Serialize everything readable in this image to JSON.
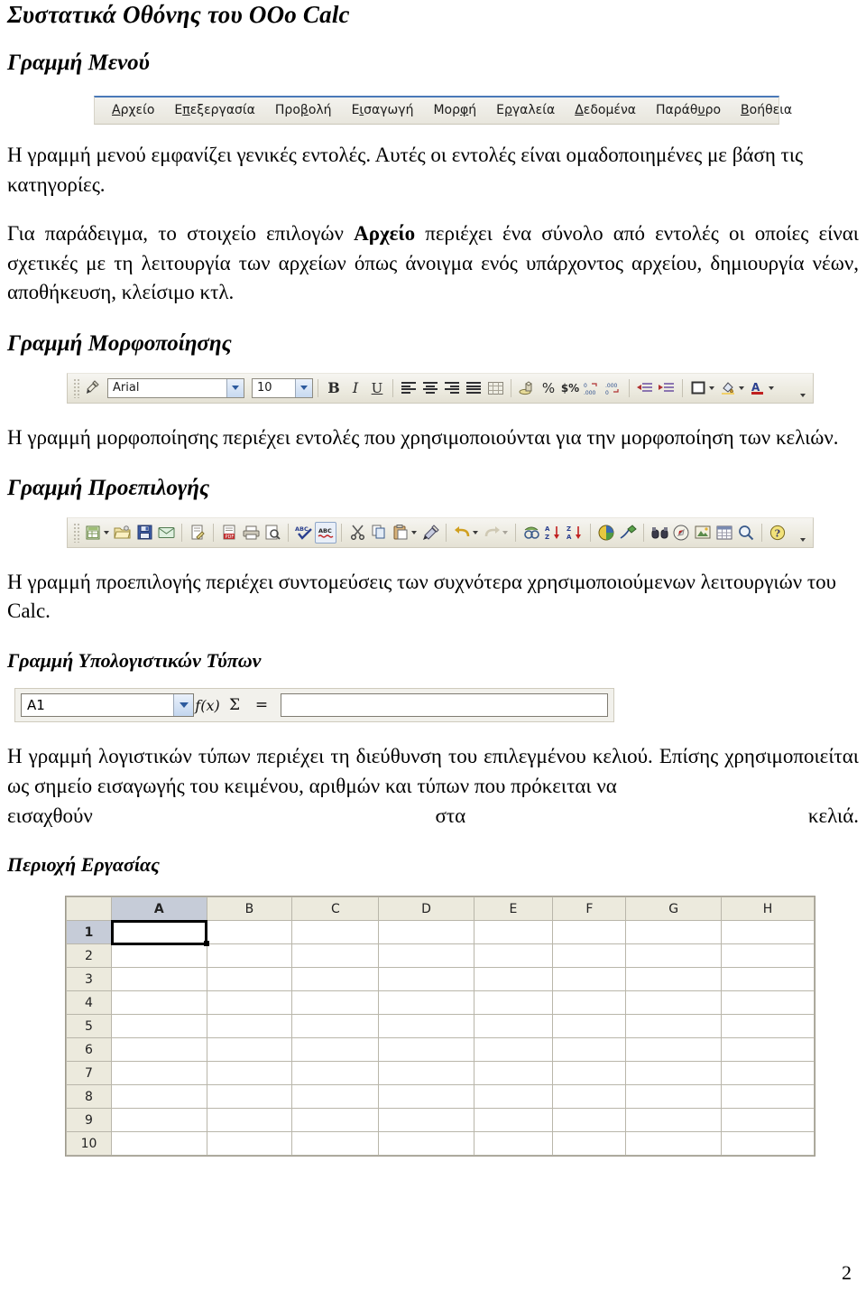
{
  "document": {
    "title": "Συστατικά Οθόνης του ΟΟo Calc",
    "page_number": "2"
  },
  "sections": {
    "menubar": {
      "heading": "Γραμμή Μενού",
      "items": [
        {
          "pre": "",
          "acc": "Α",
          "post": "ρχείο"
        },
        {
          "pre": "Ε",
          "acc": "π",
          "post": "εξεργασία"
        },
        {
          "pre": "Προ",
          "acc": "β",
          "post": "ολή"
        },
        {
          "pre": "Ε",
          "acc": "ι",
          "post": "σαγωγή"
        },
        {
          "pre": "Μορ",
          "acc": "φ",
          "post": "ή"
        },
        {
          "pre": "Ε",
          "acc": "ρ",
          "post": "γαλεία"
        },
        {
          "pre": "",
          "acc": "Δ",
          "post": "εδομένα"
        },
        {
          "pre": "Παράθ",
          "acc": "υ",
          "post": "ρο"
        },
        {
          "pre": "",
          "acc": "Β",
          "post": "οήθεια"
        }
      ],
      "body_line1": "Η γραμμή μενού εμφανίζει γενικές εντολές. Αυτές οι εντολές είναι ομαδοποιημένες με βάση τις",
      "body_line2": "κατηγορίες.",
      "body2_before": "Για παράδειγμα, το στοιχείο επιλογών ",
      "body2_bold": "Αρχείο",
      "body2_after": " περιέχει ένα σύνολο από εντολές οι οποίες είναι σχετικές με τη λειτουργία των αρχείων όπως άνοιγμα ενός υπάρχοντος αρχείου, δημιουργία νέων, αποθήκευση, κλείσιμο κτλ."
    },
    "formatbar": {
      "heading": "Γραμμή Μορφοποίησης",
      "font_name": "Arial",
      "font_size": "10",
      "bold_label": "B",
      "italic_label": "I",
      "underline_label": "U",
      "percent_label": "%",
      "currency_label": "$%",
      "body": "Η γραμμή μορφοποίησης περιέχει εντολές που χρησιμοποιούνται για την μορφοποίηση των κελιών."
    },
    "standardbar": {
      "heading": "Γραμμή Προεπιλογής",
      "spell_label": "ABC",
      "autospell_label": "ABC",
      "sort_az_label": "A Z",
      "sort_za_label": "Z A",
      "body": "Η γραμμή προεπιλογής περιέχει συντομεύσεις των συχνότερα χρησιμοποιούμενων λειτουργιών του Calc."
    },
    "formulabar": {
      "heading": "Γραμμή Υπολογιστικών Τύπων",
      "name_box_value": "A1",
      "function_wizard_label": "f(x)",
      "sum_label": "Σ",
      "equals_label": "=",
      "input_line_value": "",
      "body_line1": "Η γραμμή λογιστικών τύπων περιέχει τη διεύθυνση του επιλεγμένου κελιού. Επίσης",
      "body_line2": "χρησιμοποιείται ως σημείο εισαγωγής του κειμένου, αριθμών και τύπων που πρόκειται να",
      "body_line3_a": "εισαχθούν",
      "body_line3_b": "στα",
      "body_line3_c": "κελιά."
    },
    "worksheet": {
      "heading": "Περιοχή Εργασίας",
      "columns": [
        "A",
        "B",
        "C",
        "D",
        "E",
        "F",
        "G",
        "H"
      ],
      "rows": [
        "1",
        "2",
        "3",
        "4",
        "5",
        "6",
        "7",
        "8",
        "9",
        "10"
      ],
      "selected_cell": "A1",
      "selected_column": "A",
      "selected_row": "1",
      "corner_label": ""
    }
  },
  "colors": {
    "menubar_accent": "#4a79b8",
    "toolbar_face": "#eceadf",
    "header_face": "#eceadd",
    "header_selected": "#c6ccd8",
    "grid_line": "#b9b6aa"
  }
}
